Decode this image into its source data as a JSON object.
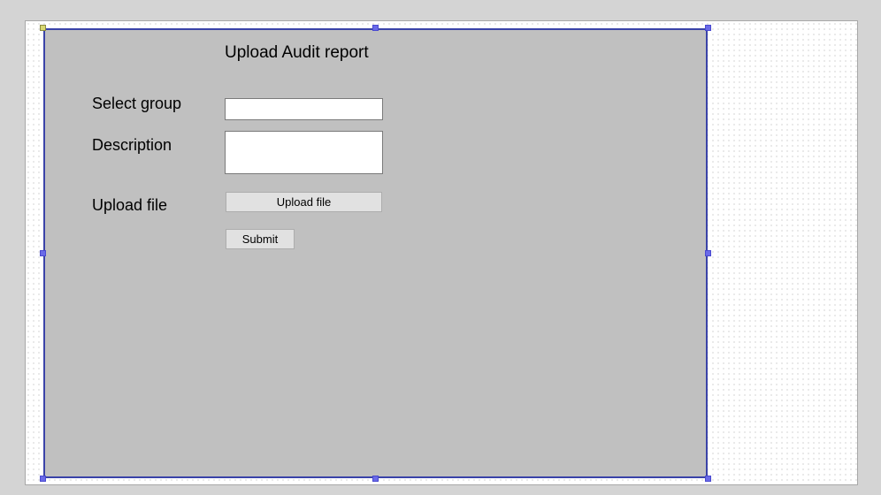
{
  "form": {
    "title": "Upload Audit report",
    "fields": {
      "group_label": "Select group",
      "group_value": "",
      "description_label": "Description",
      "description_value": "",
      "upload_label": "Upload file"
    },
    "buttons": {
      "upload_label": "Upload file",
      "submit_label": "Submit"
    }
  },
  "colors": {
    "form_background": "#c0c0c0",
    "selection_border": "#3a43a8",
    "handle": "#6a6ae8",
    "button_face": "#e1e1e1"
  }
}
